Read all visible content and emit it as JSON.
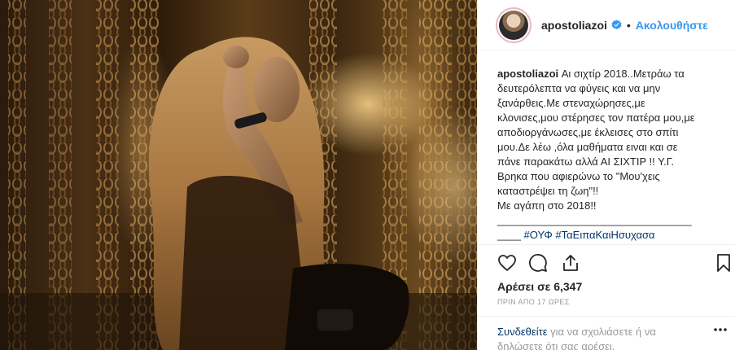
{
  "post": {
    "username": "apostoliazoi",
    "dot": "•",
    "follow_label": "Ακολουθήστε",
    "caption_lines": [
      "Αι σιχτίρ 2018..Μετράω τα",
      "δευτερόλεπτα να φύγεις και να μην",
      "ξανάρθεις.Με στεναχώρησες,με",
      "κλονισες,μου στέρησες τον πατέρα μου,με",
      "αποδιοργάνωσες,με έκλεισες στο σπίτι",
      "μου.Δε λέω ,όλα μαθήματα ειναι και σε",
      "πάνε παρακάτω αλλά ΑΙ ΣΙΧΤΙΡ !! Υ.Γ.",
      "Βρηκα που αφιερώνω το \"Μου'χεις",
      "καταστρέψει τη ζωη\"!!",
      "Με αγάπη στο 2018!!",
      "_________________________________",
      "____"
    ],
    "hashtags": [
      "#ΟΥΦ",
      "#ΤαΕιπαΚαιΗσυχασα"
    ],
    "likes": "Αρέσει σε 6,347",
    "timestamp": "ΠΡΙΝ ΑΠΟ 17 ΩΡΕΣ",
    "comment_login": "Συνδεθείτε",
    "comment_rest": " για να σχολιάσετε ή να δηλώσετε ότι σας αρέσει."
  },
  "icons": {
    "like": "heart-icon",
    "comment": "comment-bubble-icon",
    "share": "share-icon",
    "save": "bookmark-icon",
    "more": "more-dots-icon",
    "verified": "verified-badge-icon"
  },
  "colors": {
    "link": "#3897f0",
    "hashtag": "#003569",
    "muted": "#999999",
    "text": "#262626"
  }
}
